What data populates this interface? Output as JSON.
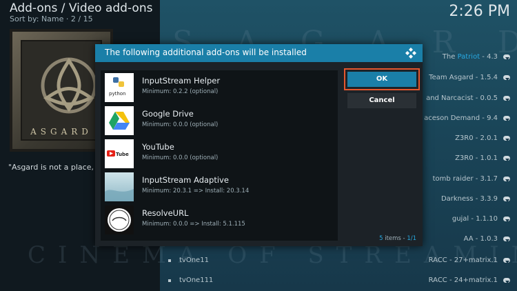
{
  "header": {
    "title": "Add-ons / Video add-ons",
    "sort": "Sort by: Name  ·  2 / 15",
    "clock": "2:26 PM"
  },
  "background": {
    "watermark_top": "S  A  G  A  R  D",
    "watermark_bottom": "CINEMA OF STREAMING"
  },
  "poster": {
    "text": "ASGARD"
  },
  "description": "\"Asgard is not a place, i",
  "addon_list": [
    {
      "prefix": "The ",
      "highlight": "Patriot",
      "suffix": " - 4.3"
    },
    {
      "prefix": "Team Asgard - 1.5.4",
      "highlight": "",
      "suffix": ""
    },
    {
      "prefix": "and Narcacist - 0.0.5",
      "highlight": "",
      "suffix": ""
    },
    {
      "prefix": "aceson Demand - 9.4",
      "highlight": "",
      "suffix": ""
    },
    {
      "prefix": "Z3R0 - 2.0.1",
      "highlight": "",
      "suffix": ""
    },
    {
      "prefix": "Z3R0 - 1.0.1",
      "highlight": "",
      "suffix": ""
    },
    {
      "prefix": "tomb raider - 3.1.7",
      "highlight": "",
      "suffix": ""
    },
    {
      "prefix": "Darkness - 3.3.9",
      "highlight": "",
      "suffix": ""
    },
    {
      "prefix": "gujal - 1.1.10",
      "highlight": "",
      "suffix": ""
    },
    {
      "prefix": "AA - 1.0.3",
      "highlight": "",
      "suffix": ""
    },
    {
      "prefix": "RACC - 27+matrix.1",
      "highlight": "",
      "suffix": ""
    },
    {
      "prefix": "RACC - 24+matrix.1",
      "highlight": "",
      "suffix": ""
    }
  ],
  "bottom_rows": [
    "tvOne11",
    "tvOne111"
  ],
  "dialog": {
    "title": "The following additional add-ons will be installed",
    "ok_label": "OK",
    "cancel_label": "Cancel",
    "count_num": "5",
    "count_text": " items - ",
    "count_page": "1/1",
    "items": [
      {
        "name": "InputStream Helper",
        "version": "Minimum: 0.2.2 (optional)",
        "icon": "python-icon"
      },
      {
        "name": "Google Drive",
        "version": "Minimum: 0.0.0 (optional)",
        "icon": "google-drive-icon"
      },
      {
        "name": "YouTube",
        "version": "Minimum: 0.0.0 (optional)",
        "icon": "youtube-icon"
      },
      {
        "name": "InputStream Adaptive",
        "version": "Minimum: 20.3.1 => Install: 20.3.14",
        "icon": "inputstream-adaptive-icon"
      },
      {
        "name": "ResolveURL",
        "version": "Minimum: 0.0.0 => Install: 5.1.115",
        "icon": "resolveurl-icon"
      }
    ]
  },
  "colors": {
    "accent": "#1a7fa8",
    "focus_outline": "#e4572e",
    "highlight_text": "#27a9e1"
  }
}
